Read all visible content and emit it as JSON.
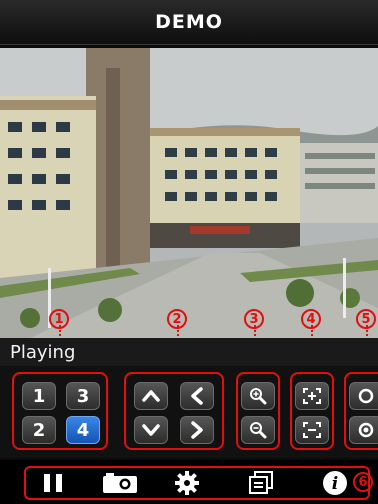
{
  "header": {
    "title": "DEMO"
  },
  "status": {
    "text": "Playing"
  },
  "markers": [
    "1",
    "2",
    "3",
    "4",
    "5",
    "6"
  ],
  "channels": [
    "1",
    "3",
    "2",
    "4"
  ],
  "active_channel": "4",
  "ptz": [
    "arrow-up-icon",
    "arrow-left-icon",
    "arrow-down-icon",
    "arrow-right-icon"
  ],
  "zoom": [
    "zoom-in-icon",
    "zoom-out-icon"
  ],
  "focus": [
    "focus-near-icon",
    "focus-far-icon"
  ],
  "iris": [
    "iris-open-icon",
    "iris-close-icon"
  ],
  "toolbar": [
    "pause-icon",
    "camera-icon",
    "gear-icon",
    "window-icon",
    "info-icon"
  ],
  "colors": {
    "accent": "#e10f0f",
    "active": "#1f6fd6"
  }
}
